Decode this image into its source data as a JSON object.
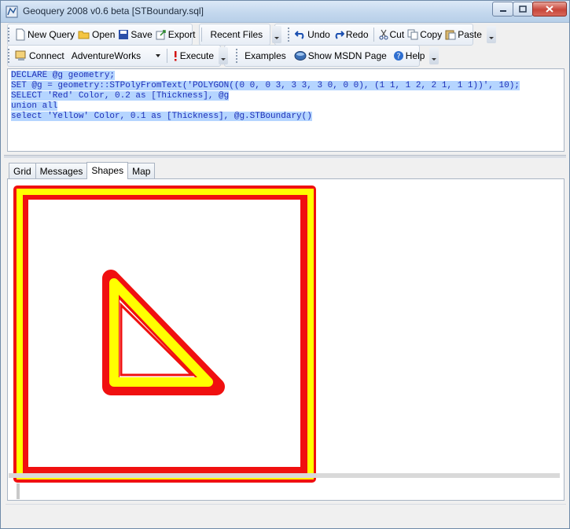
{
  "window": {
    "title": "Geoquery 2008 v0.6 beta [STBoundary.sql]"
  },
  "toolbar1": {
    "new_query": "New Query",
    "open": "Open",
    "save": "Save",
    "export": "Export",
    "recent_files": "Recent Files",
    "undo": "Undo",
    "redo": "Redo",
    "cut": "Cut",
    "copy": "Copy",
    "paste": "Paste"
  },
  "toolbar2": {
    "connect": "Connect",
    "database": "AdventureWorks",
    "execute": "Execute",
    "examples": "Examples",
    "msdn": "Show MSDN Page",
    "help": "Help"
  },
  "editor": {
    "lines": [
      "DECLARE @g geometry;",
      "SET @g = geometry::STPolyFromText('POLYGON((0 0, 0 3, 3 3, 3 0, 0 0), (1 1, 1 2, 2 1, 1 1))', 10);",
      "SELECT 'Red' Color, 0.2 as [Thickness], @g",
      "union all",
      "select 'Yellow' Color, 0.1 as [Thickness], @g.STBoundary()"
    ]
  },
  "tabs": [
    "Grid",
    "Messages",
    "Shapes",
    "Map"
  ],
  "active_tab": "Shapes",
  "shapes": {
    "red_color": "#f01010",
    "yellow_color": "#ffff00"
  }
}
